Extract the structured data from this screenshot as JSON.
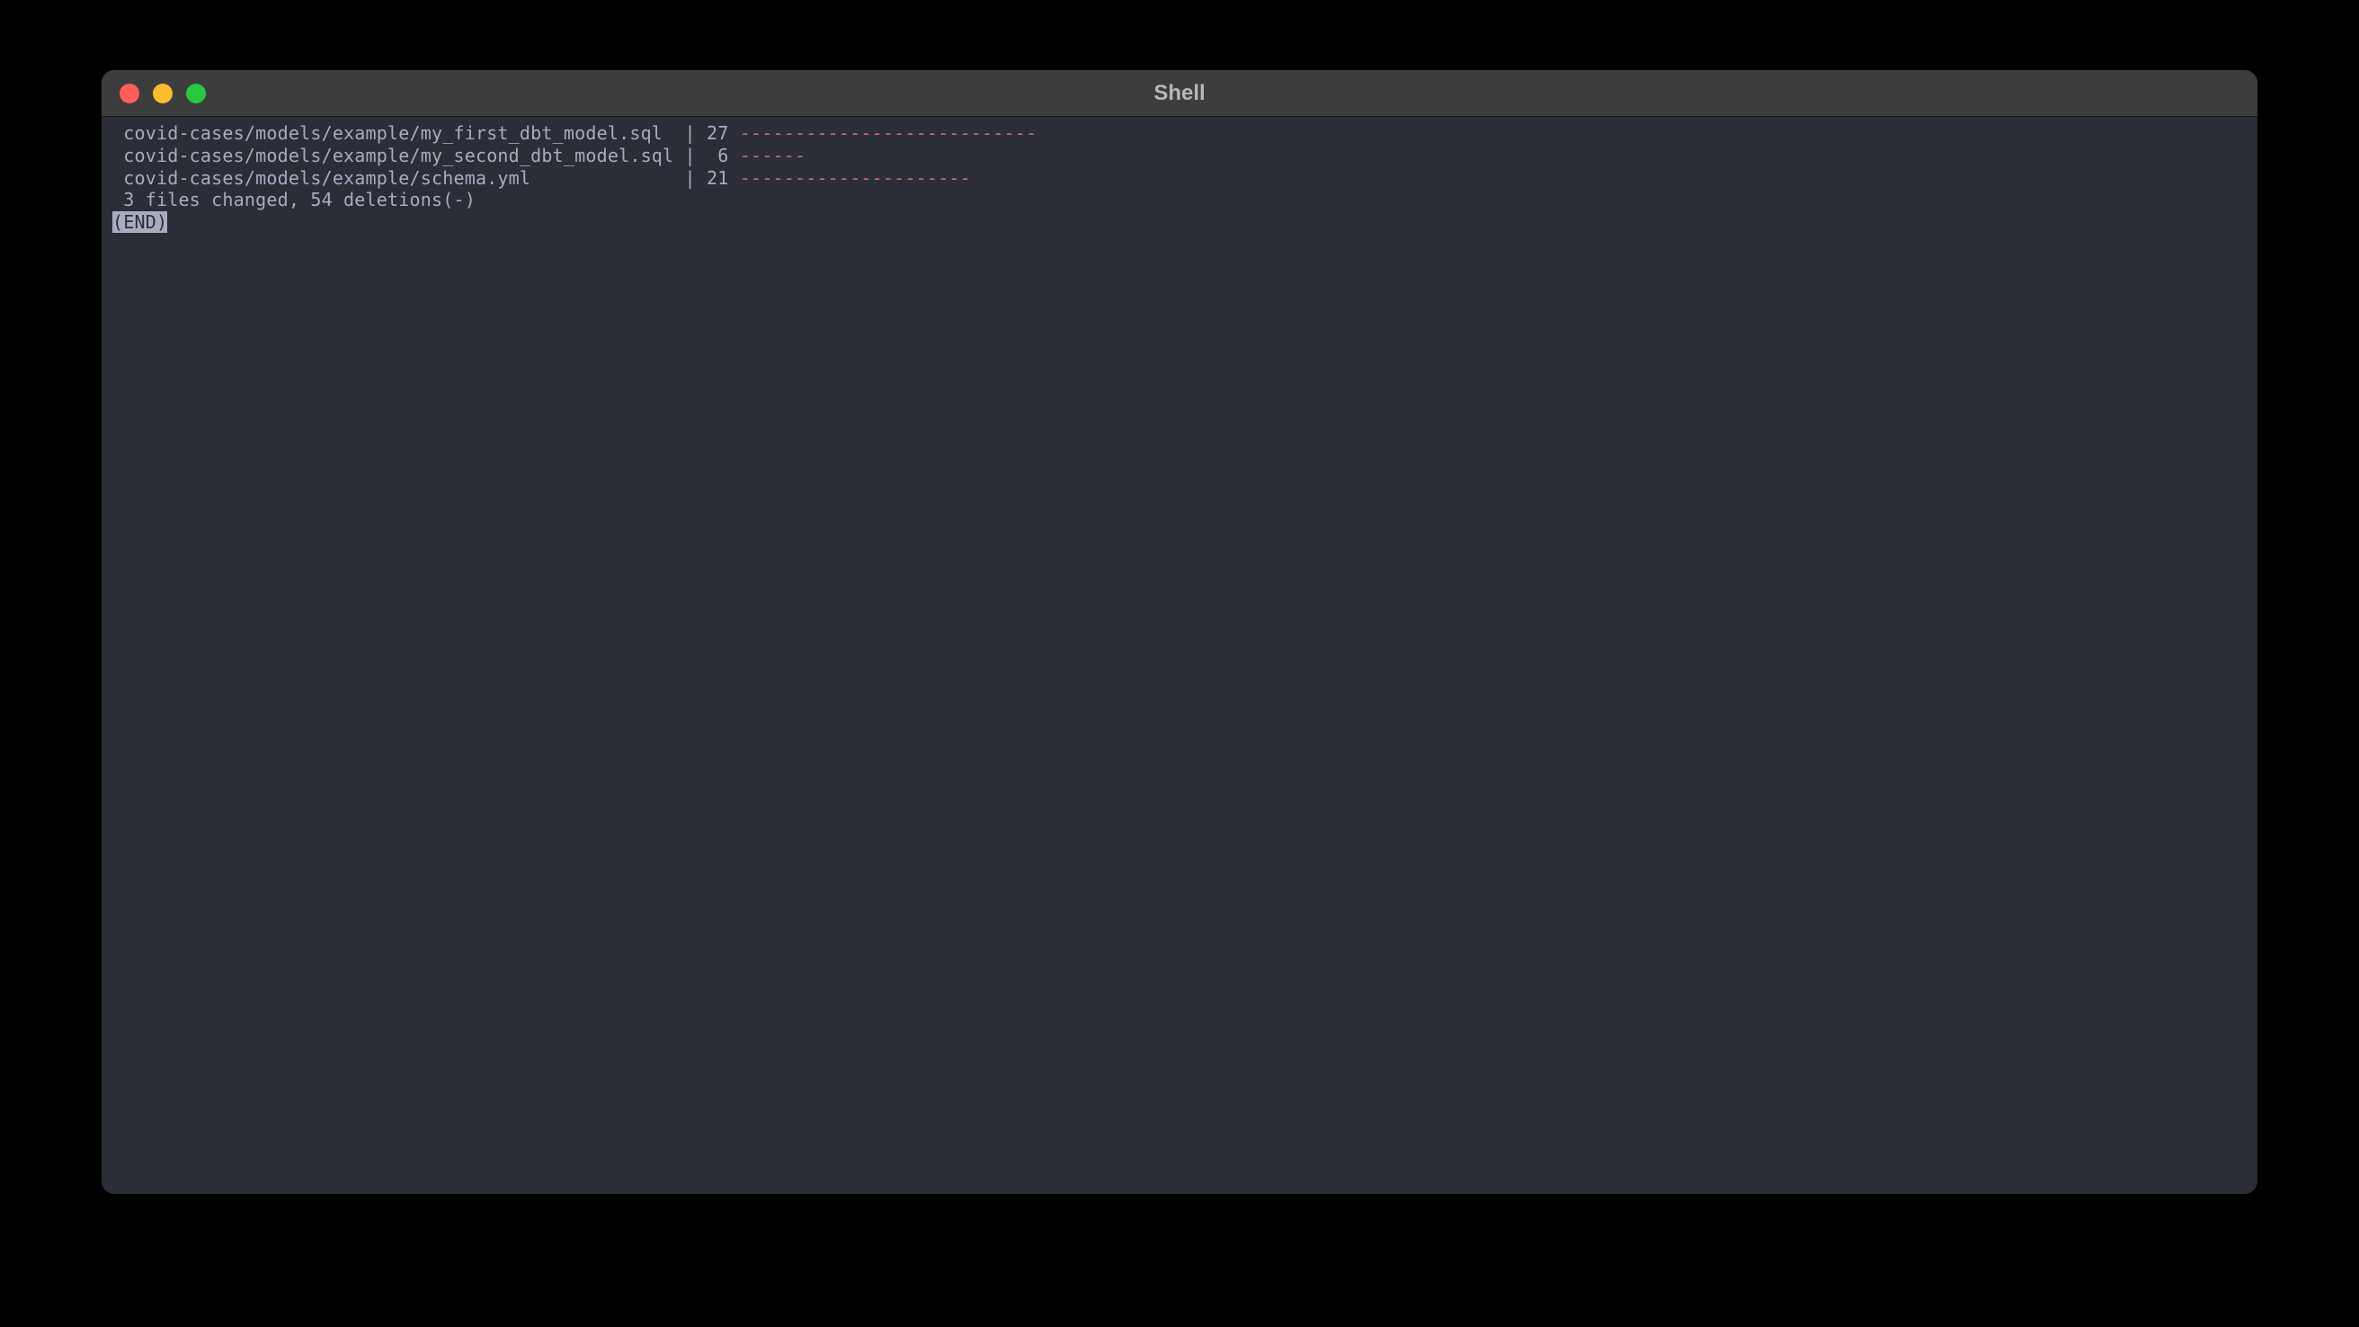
{
  "window": {
    "title": "Shell"
  },
  "diff": {
    "lines": [
      {
        "path": " covid-cases/models/example/my_first_dbt_model.sql  | 27 ",
        "marks": "---------------------------"
      },
      {
        "path": " covid-cases/models/example/my_second_dbt_model.sql |  6 ",
        "marks": "------"
      },
      {
        "path": " covid-cases/models/example/schema.yml              | 21 ",
        "marks": "---------------------"
      }
    ],
    "summary": " 3 files changed, 54 deletions(-)",
    "end_label": "(END)"
  }
}
